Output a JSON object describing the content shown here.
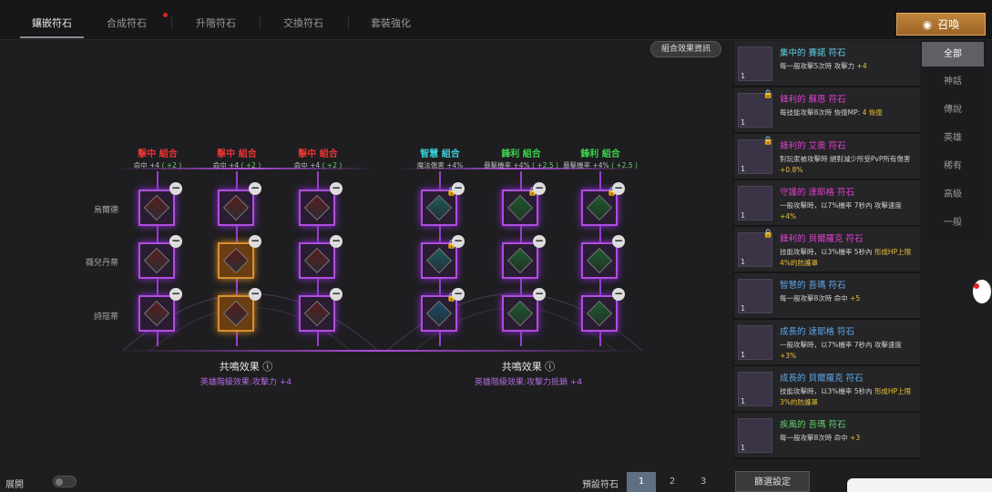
{
  "tabs": [
    "鑲嵌符石",
    "合成符石",
    "升階符石",
    "交換符石",
    "套裝強化"
  ],
  "summon_label": "召喚",
  "combo_info_label": "組合效果資訊",
  "row_labels": [
    "烏爾德",
    "薇兒丹蒂",
    "詩寇蒂"
  ],
  "combos_left": [
    {
      "name": "擊中 組合",
      "eff": "命中 +4",
      "bonus": "( +2 )"
    },
    {
      "name": "擊中 組合",
      "eff": "命中 +4",
      "bonus": "( +2 )"
    },
    {
      "name": "擊中 組合",
      "eff": "命中 +4",
      "bonus": "( +2 )"
    }
  ],
  "combos_right": [
    {
      "name": "智慧 組合",
      "eff": "魔法傷害 +4%",
      "bonus": ""
    },
    {
      "name": "鋒利 組合",
      "eff": "暴擊機率 +4%",
      "bonus": "( +2.5 )"
    },
    {
      "name": "鋒利 組合",
      "eff": "暴擊機率 +4%",
      "bonus": "( +2.5 )"
    }
  ],
  "resonance_left": {
    "title": "共鳴效果",
    "value": "英雄階級效果:攻擊力 +4"
  },
  "resonance_right": {
    "title": "共鳴效果",
    "value": "英雄階級效果:攻擊力抵銷 +4"
  },
  "info_icon": "ⓘ",
  "colors": {
    "combo_red": "#e83535",
    "combo_teal": "#3ad0d8",
    "combo_green": "#3ed24e",
    "slot_purple": "#b14de0",
    "accent_gold": "#c0843c"
  },
  "runes": [
    {
      "name": "集中的 賽諾 符石",
      "desc": [
        "每一般攻擊5次時 攻擊力 ",
        "+4"
      ],
      "name_color": "#5fd0e8",
      "count": "1",
      "locked": false
    },
    {
      "name": "鋒利的 蘇恩 符石",
      "desc": [
        "每技能攻擊8次時 恢復MP: ",
        "4 恢復"
      ],
      "name_color": "#e040d0",
      "count": "1",
      "locked": true
    },
    {
      "name": "鋒利的 艾奧 符石",
      "desc": [
        "對玩家被攻擊時 絕對減少所受PvP所有傷害 ",
        "+0.8%"
      ],
      "name_color": "#e040d0",
      "count": "1",
      "locked": true
    },
    {
      "name": "守護的 達耶格 符石",
      "desc": [
        "一般攻擊時，以7%機率 7秒內 攻擊速度 ",
        "+4%"
      ],
      "name_color": "#e040d0",
      "count": "1",
      "locked": false
    },
    {
      "name": "鋒利的 貝爾羅克 符石",
      "desc": [
        "技能攻擊時，以3%機率 5秒內 ",
        "形成HP上限4%的防護罩"
      ],
      "name_color": "#e040d0",
      "count": "1",
      "locked": true
    },
    {
      "name": "智慧的 吾瑪 符石",
      "desc": [
        "每一般攻擊8次時 命中 ",
        "+5"
      ],
      "name_color": "#5fa8e8",
      "count": "1",
      "locked": false
    },
    {
      "name": "成長的 達耶格 符石",
      "desc": [
        "一般攻擊時，以7%機率 7秒內 攻擊速度 ",
        "+3%"
      ],
      "name_color": "#5fa8e8",
      "count": "1",
      "locked": false
    },
    {
      "name": "成長的 貝爾羅克 符石",
      "desc": [
        "技能攻擊時，以3%機率 5秒內 ",
        "形成HP上限3%的防護罩"
      ],
      "name_color": "#5fa8e8",
      "count": "1",
      "locked": false
    },
    {
      "name": "疾風的 吾瑪 符石",
      "desc": [
        "每一般攻擊8次時 命中 ",
        "+3"
      ],
      "name_color": "#5fd06a",
      "count": "1",
      "locked": false
    }
  ],
  "categories": [
    "全部",
    "神話",
    "傳說",
    "英雄",
    "稀有",
    "高級",
    "一般"
  ],
  "expand_label": "展開",
  "preset_label": "預設符石",
  "presets": [
    "1",
    "2",
    "3"
  ],
  "filter_label": "篩選設定"
}
